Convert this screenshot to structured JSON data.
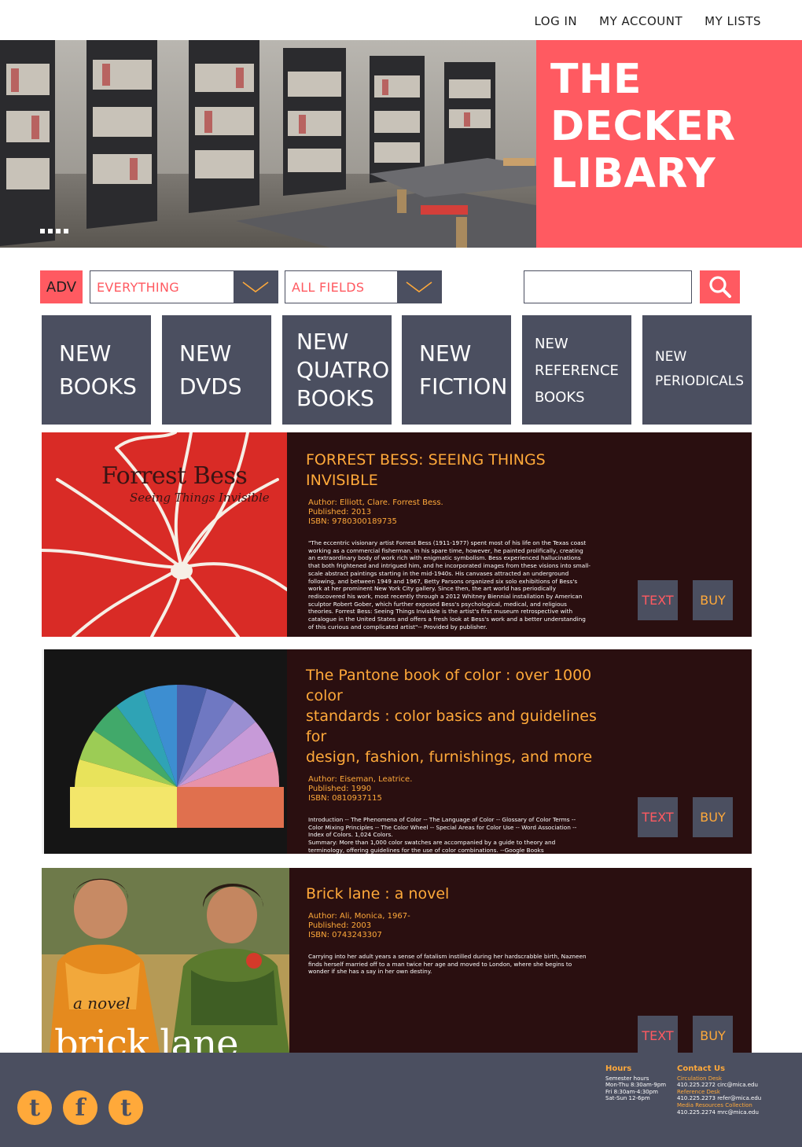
{
  "topnav": {
    "login": "LOG IN",
    "account": "MY ACCOUNT",
    "lists": "MY LISTS"
  },
  "hero": {
    "title": "THE\nDECKER\nLIBARY"
  },
  "search": {
    "adv_label": "ADV",
    "scope_value": "EVERYTHING",
    "field_value": "ALL FIELDS",
    "query_value": ""
  },
  "categories": [
    {
      "label": "NEW\nBOOKS"
    },
    {
      "label": "NEW\nDVDS"
    },
    {
      "label": "NEW\nQUATRO\nBOOKS"
    },
    {
      "label": "NEW\nFICTION"
    },
    {
      "label": "NEW\nREFERENCE\nBOOKS"
    },
    {
      "label": "NEW\nPERIODICALS"
    }
  ],
  "books": [
    {
      "title": "FORREST BESS: SEEING THINGS INVISIBLE",
      "cover_title": "Forrest Bess",
      "cover_subtitle": "Seeing Things Invisible",
      "author": "Author: Elliott, Clare. Forrest Bess.",
      "published": "Published: 2013",
      "isbn": "ISBN: 9780300189735",
      "description": "\"The eccentric visionary artist Forrest Bess (1911-1977) spent most of his life on the Texas coast working as a commercial fisherman. In his spare time, however, he painted prolifically, creating an extraordinary body of work rich with enigmatic symbolism. Bess experienced hallucinations that both frightened and intrigued him, and he incorporated images from these visions into small-scale abstract paintings starting in the mid-1940s. His canvases attracted an underground following, and between 1949 and 1967, Betty Parsons organized six solo exhibitions of Bess's work at her prominent New York City gallery. Since then, the art world has periodically rediscovered his work, most recently through a 2012 Whitney Biennial installation by American sculptor Robert Gober, which further exposed Bess's psychological, medical, and religious theories. Forrest Bess: Seeing Things Invisible is the artist's first museum retrospective with catalogue in the United States and offers a fresh look at Bess's work and a better understanding of this curious and complicated artist\"-- Provided by publisher.",
      "text_label": "TEXT",
      "buy_label": "BUY"
    },
    {
      "title": "The Pantone book of color : over 1000 color\n standards : color basics and guidelines for\ndesign, fashion, furnishings, and more",
      "author": "Author: Eiseman, Leatrice.",
      "published": "Published: 1990",
      "isbn": "ISBN: 0810937115",
      "description": "Introduction -- The Phenomena of Color -- The Language of Color -- Glossary of Color Terms -- Color Mixing Principles -- The Color Wheel -- Special Areas for Color Use -- Word Association -- Index of Colors. 1,024 Colors.\nSummary: More than 1,000 color swatches are accompanied by a guide to theory and terminology, offering guidelines for the use of color combinations. --Google Books",
      "text_label": "TEXT",
      "buy_label": "BUY"
    },
    {
      "title": "Brick lane : a novel",
      "cover_kicker": "a novel",
      "cover_title": "brick lane",
      "author": "Author: Ali, Monica, 1967-",
      "published": "Published: 2003",
      "isbn": "ISBN: 0743243307",
      "description": "Carrying into her adult years a sense of fatalism instilled during her hardscrabble birth, Nazneen finds herself married off to a man twice her age and moved to London, where she begins to wonder if she has a say in her own destiny.",
      "text_label": "TEXT",
      "buy_label": "BUY"
    }
  ],
  "footer": {
    "hours_heading": "Hours",
    "hours_lines": [
      "Semester hours",
      "Mon-Thu 8:30am-9pm",
      "Fri 8:30am-4:30pm",
      "Sat-Sun 12-6pm"
    ],
    "contact_heading": "Contact Us",
    "circ_label": "Circulation Desk",
    "circ_value": "410.225.2272 circ@mica.edu",
    "ref_label": "Reference Desk",
    "ref_value": "410.225.2273 refer@mica.edu",
    "media_label": "Media Resources Collection",
    "media_value": "410.225.2274 mrc@mica.edu",
    "social": [
      "tumblr-icon",
      "facebook-icon",
      "twitter-icon"
    ]
  },
  "colors": {
    "accent": "#ff5a61",
    "slate": "#4b4f60",
    "card": "#2a0f10",
    "orange": "#ffa93a"
  }
}
